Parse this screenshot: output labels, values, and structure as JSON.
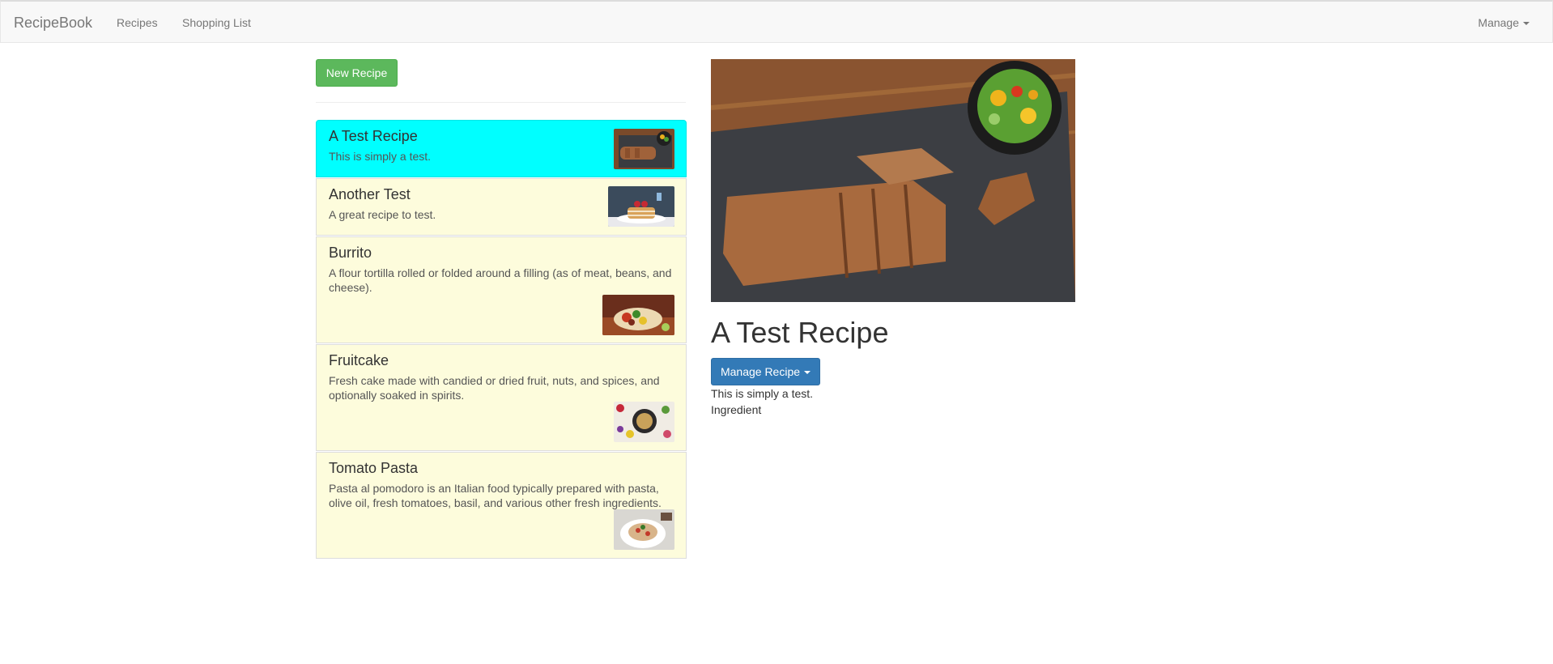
{
  "navbar": {
    "brand": "RecipeBook",
    "links": [
      "Recipes",
      "Shopping List"
    ],
    "manage_label": "Manage"
  },
  "list": {
    "new_button_label": "New Recipe",
    "recipes": [
      {
        "name": "A Test Recipe",
        "description": "This is simply a test.",
        "active": true
      },
      {
        "name": "Another Test",
        "description": "A great recipe to test.",
        "active": false
      },
      {
        "name": "Burrito",
        "description": "A flour tortilla rolled or folded around a filling (as of meat, beans, and cheese).",
        "active": false
      },
      {
        "name": "Fruitcake",
        "description": "Fresh cake made with candied or dried fruit, nuts, and spices, and optionally soaked in spirits.",
        "active": false
      },
      {
        "name": "Tomato Pasta",
        "description": "Pasta al pomodoro is an Italian food typically prepared with pasta, olive oil, fresh tomatoes, basil, and various other fresh ingredients.",
        "active": false
      }
    ]
  },
  "detail": {
    "title": "A Test Recipe",
    "manage_button_label": "Manage Recipe",
    "description": "This is simply a test.",
    "ingredient_label": "Ingredient"
  },
  "colors": {
    "active_item": "#00ffff",
    "item_background": "#fdfcdc",
    "success_button": "#5cb85c",
    "primary_button": "#337ab7"
  }
}
